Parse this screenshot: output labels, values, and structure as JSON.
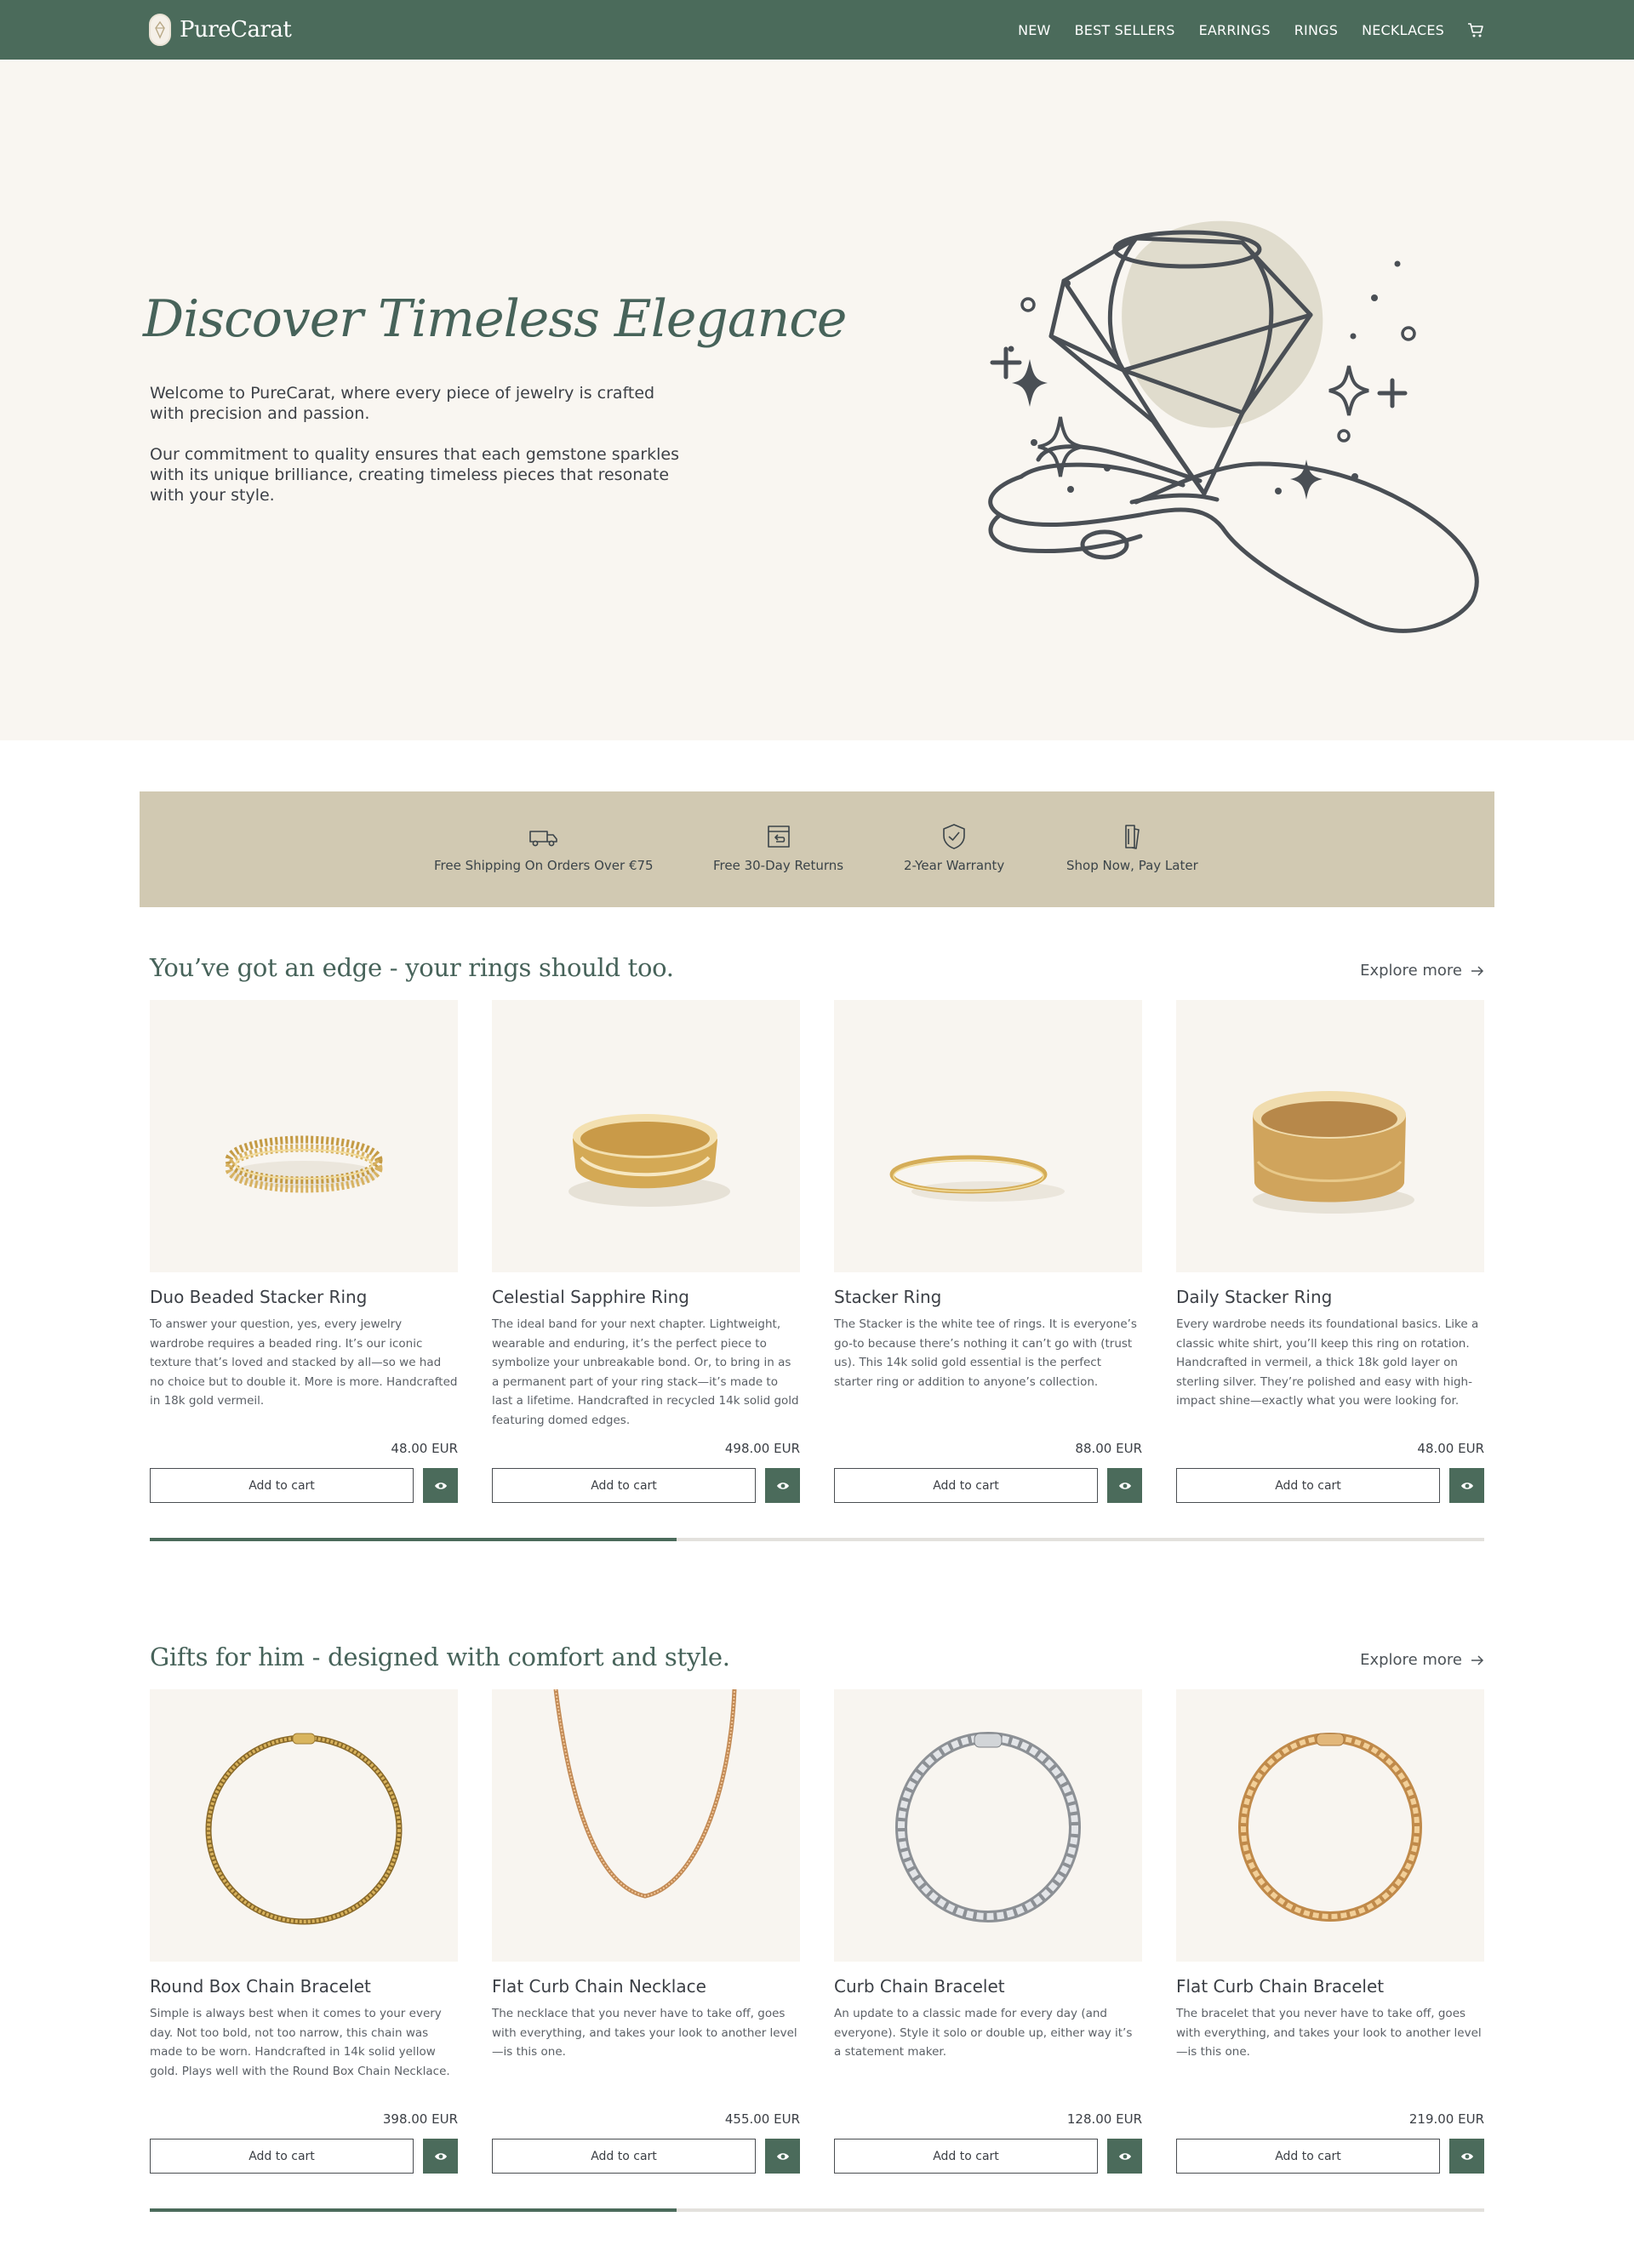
{
  "brand": {
    "name": "PureCarat",
    "accent_color": "#4b6b5b",
    "beige_color": "#d1c9b2"
  },
  "nav": {
    "items": [
      "NEW",
      "BEST SELLERS",
      "EARRINGS",
      "RINGS",
      "NECKLACES"
    ],
    "cart_icon": "cart-icon"
  },
  "hero": {
    "title": "Discover Timeless Elegance",
    "paragraph1": "Welcome to PureCarat, where every piece of jewelry is crafted with precision and passion.",
    "paragraph2": "Our commitment to quality ensures that each gemstone sparkles with its unique brilliance, creating timeless pieces that resonate with your style.",
    "illustration_icon": "diamond-in-hand-icon"
  },
  "features": [
    {
      "icon": "delivery-truck-icon",
      "label": "Free Shipping On Orders Over €75"
    },
    {
      "icon": "return-box-icon",
      "label": "Free 30-Day Returns"
    },
    {
      "icon": "shield-check-icon",
      "label": "2-Year Warranty"
    },
    {
      "icon": "card-pay-icon",
      "label": "Shop Now, Pay Later"
    }
  ],
  "sections": [
    {
      "title": "You’ve got an edge - your rings should too.",
      "explore_label": "Explore more",
      "scroll_progress": 0.395,
      "products": [
        {
          "name": "Duo Beaded Stacker Ring",
          "description": "To answer your question, yes, every jewelry wardrobe requires a beaded ring. It’s our iconic texture that’s loved and stacked by all—so we had no choice but to double it. More is more. Handcrafted in 18k gold vermeil.",
          "price": "48.00 EUR",
          "add_label": "Add to cart"
        },
        {
          "name": "Celestial Sapphire Ring",
          "description": "The ideal band for your next chapter. Lightweight, wearable and enduring, it’s the perfect piece to symbolize your unbreakable bond. Or, to bring in as a permanent part of your ring stack—it’s made to last a lifetime. Handcrafted in recycled 14k solid gold featuring domed edges.",
          "price": "498.00 EUR",
          "add_label": "Add to cart"
        },
        {
          "name": "Stacker Ring",
          "description": "The Stacker is the white tee of rings. It is everyone’s go-to because there’s nothing it can’t go with (trust us). This 14k solid gold essential is the perfect starter ring or addition to anyone’s collection.",
          "price": "88.00 EUR",
          "add_label": "Add to cart"
        },
        {
          "name": "Daily Stacker Ring",
          "description": "Every wardrobe needs its foundational basics. Like a classic white shirt, you’ll keep this ring on rotation. Handcrafted in vermeil, a thick 18k gold layer on sterling silver. They’re polished and easy with high-impact shine—exactly what you were looking for.",
          "price": "48.00 EUR",
          "add_label": "Add to cart"
        }
      ]
    },
    {
      "title": "Gifts for him - designed with comfort and style.",
      "explore_label": "Explore more",
      "scroll_progress": 0.395,
      "products": [
        {
          "name": "Round Box Chain Bracelet",
          "description": "Simple is always best when it comes to your every day. Not too bold, not too narrow, this chain was made to be worn. Handcrafted in 14k solid yellow gold. Plays well with the Round Box Chain Necklace.",
          "price": "398.00 EUR",
          "add_label": "Add to cart"
        },
        {
          "name": "Flat Curb Chain Necklace",
          "description": "The necklace that you never have to take off, goes with everything, and takes your look to another level—is this one.",
          "price": "455.00 EUR",
          "add_label": "Add to cart"
        },
        {
          "name": "Curb Chain Bracelet",
          "description": "An update to a classic made for every day (and everyone). Style it solo or double up, either way it’s a statement maker.",
          "price": "128.00 EUR",
          "add_label": "Add to cart"
        },
        {
          "name": "Flat Curb Chain Bracelet",
          "description": "The bracelet that you never have to take off, goes with everything, and takes your look to another level—is this one.",
          "price": "219.00 EUR",
          "add_label": "Add to cart"
        }
      ]
    }
  ]
}
